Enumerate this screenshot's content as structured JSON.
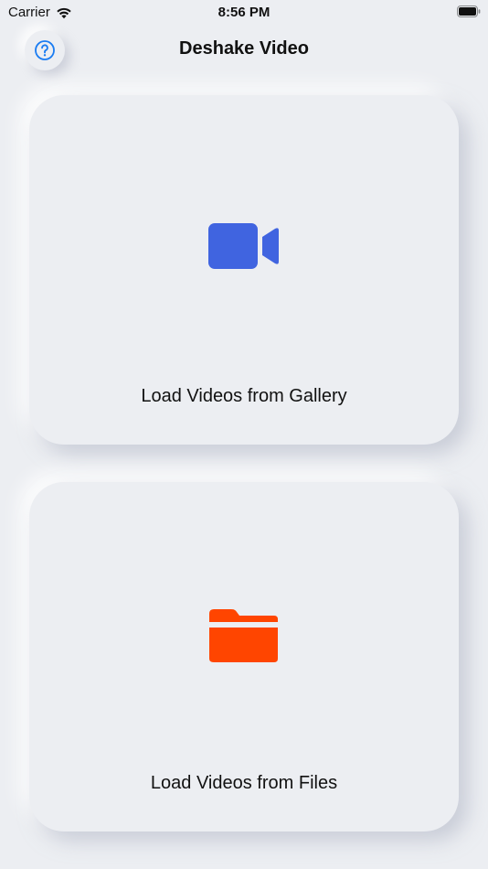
{
  "status_bar": {
    "carrier": "Carrier",
    "time": "8:56 PM"
  },
  "nav": {
    "title": "Deshake Video",
    "help_icon": "question-circle-icon"
  },
  "cards": {
    "gallery": {
      "label": "Load Videos from Gallery",
      "icon": "video-camera-icon",
      "icon_color": "#4064e0"
    },
    "files": {
      "label": "Load Videos from Files",
      "icon": "folder-icon",
      "icon_color": "#ff4500"
    }
  },
  "colors": {
    "background": "#eceef2",
    "accent_blue": "#1a7cf2"
  }
}
